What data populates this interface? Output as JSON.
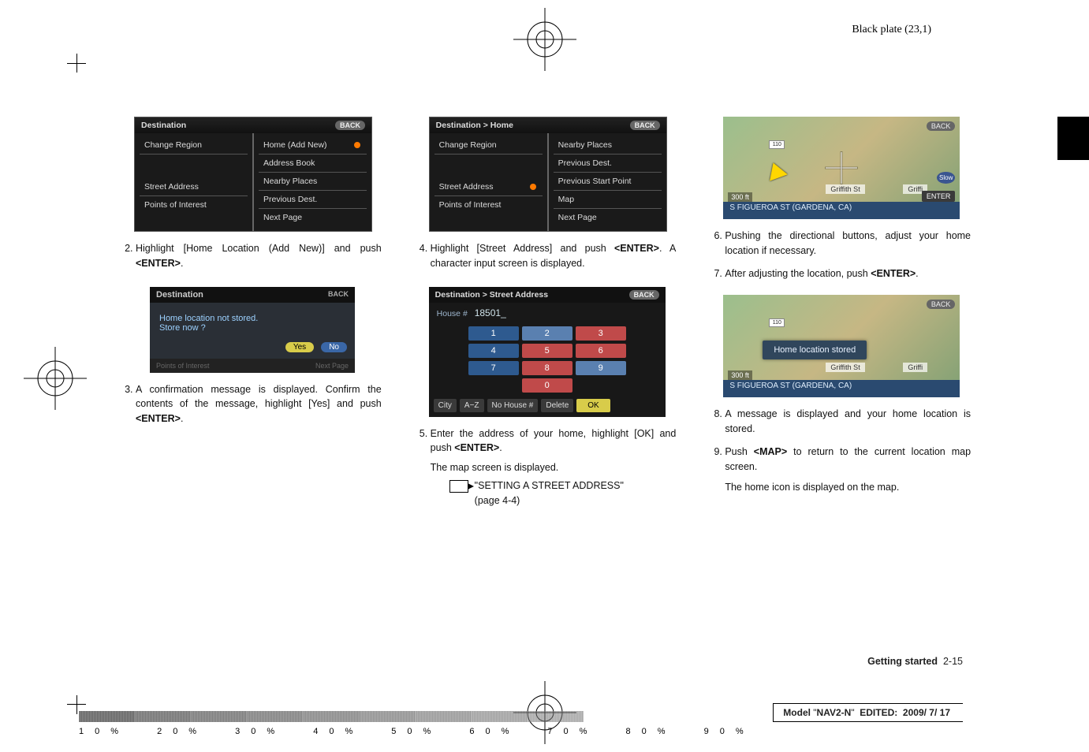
{
  "header": {
    "right": "Black plate (23,1)"
  },
  "col1": {
    "ss1": {
      "title": "Destination",
      "back": "BACK",
      "left": {
        "region": "Change Region",
        "street": "Street Address",
        "poi": "Points of Interest"
      },
      "right": {
        "home": "Home (Add New)",
        "abook": "Address Book",
        "nearby": "Nearby Places",
        "prev": "Previous Dest.",
        "next": "Next Page"
      }
    },
    "step2": "Highlight [Home Location (Add New)] and push <ENTER>.",
    "dlg": {
      "title": "Destination",
      "back": "BACK",
      "line1": "Home location not stored.",
      "line2": "Store now ?",
      "yes": "Yes",
      "no": "No",
      "foot1": "Points of Interest",
      "foot2": "Next Page"
    },
    "step3": "A confirmation message is displayed. Confirm the contents of the message, highlight [Yes] and push <ENTER>."
  },
  "col2": {
    "ss2": {
      "title": "Destination > Home",
      "back": "BACK",
      "left": {
        "region": "Change Region",
        "street": "Street Address",
        "poi": "Points of Interest"
      },
      "right": {
        "nearby": "Nearby Places",
        "prev": "Previous Dest.",
        "psp": "Previous Start Point",
        "map": "Map",
        "next": "Next Page"
      }
    },
    "step4": "Highlight [Street Address] and push <ENTER>. A character input screen is displayed.",
    "kp": {
      "title": "Destination > Street Address",
      "back": "BACK",
      "house_lbl": "House #",
      "house_val": "18501_",
      "keys": [
        "1",
        "2",
        "3",
        "4",
        "5",
        "6",
        "7",
        "8",
        "9",
        "",
        "0",
        ""
      ],
      "city": "City",
      "az": "A−Z",
      "noh": "No House #",
      "del": "Delete",
      "ok": "OK"
    },
    "step5": "Enter the address of your home, highlight [OK] and push <ENTER>.",
    "after5": "The map screen is displayed.",
    "xref": "\"SETTING A STREET ADDRESS\"",
    "xref_page": "(page 4-4)"
  },
  "col3": {
    "map1": {
      "back": "BACK",
      "street1": "Griffith St",
      "street2": "Griffi",
      "enter": "ENTER",
      "slow": "Slow",
      "dist": "300 ft",
      "shield": "110",
      "status": "S FIGUEROA ST (GARDENA, CA)"
    },
    "step6": "Pushing the directional buttons, adjust your home location if necessary.",
    "step7": "After adjusting the location, push <ENTER>.",
    "map2": {
      "back": "BACK",
      "toast": "Home location stored",
      "street1": "Griffith St",
      "street2": "Griffi",
      "dist": "300 ft",
      "shield": "110",
      "status": "S FIGUEROA ST (GARDENA, CA)"
    },
    "step8": "A message is displayed and your home location is stored.",
    "step9": "Push <MAP> to return to the current location map screen.",
    "after9": "The home icon is displayed on the map."
  },
  "footer": {
    "section": "Getting started",
    "page": "2-15",
    "pct": "10%   20%   30%   40%   50%   60%   70%   80%   90%",
    "model": "Model \"NAV2-N\"  EDITED: 2009/ 7/ 17"
  }
}
